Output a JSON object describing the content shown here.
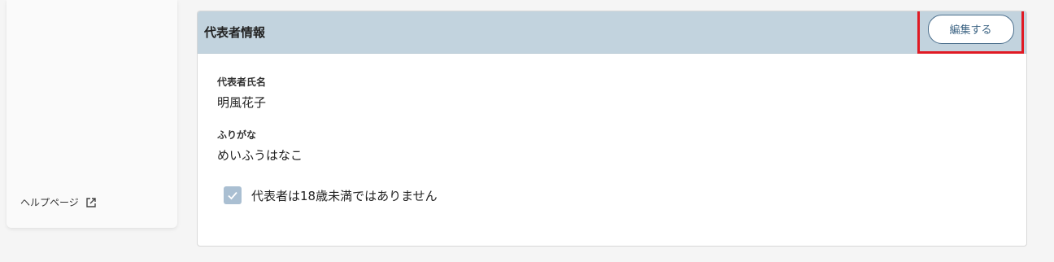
{
  "sidebar": {
    "help_label": "ヘルプページ"
  },
  "card": {
    "title": "代表者情報",
    "edit_label": "編集する",
    "fields": [
      {
        "label": "代表者氏名",
        "value": "明風花子"
      },
      {
        "label": "ふりがな",
        "value": "めいふうはなこ"
      }
    ],
    "checkbox": {
      "label": "代表者は18歳未満ではありません",
      "checked": true
    }
  },
  "colors": {
    "header_bg": "#c2d3de",
    "accent": "#3b6383",
    "highlight": "#e01a24",
    "checkbox_bg": "#aabfd2"
  }
}
